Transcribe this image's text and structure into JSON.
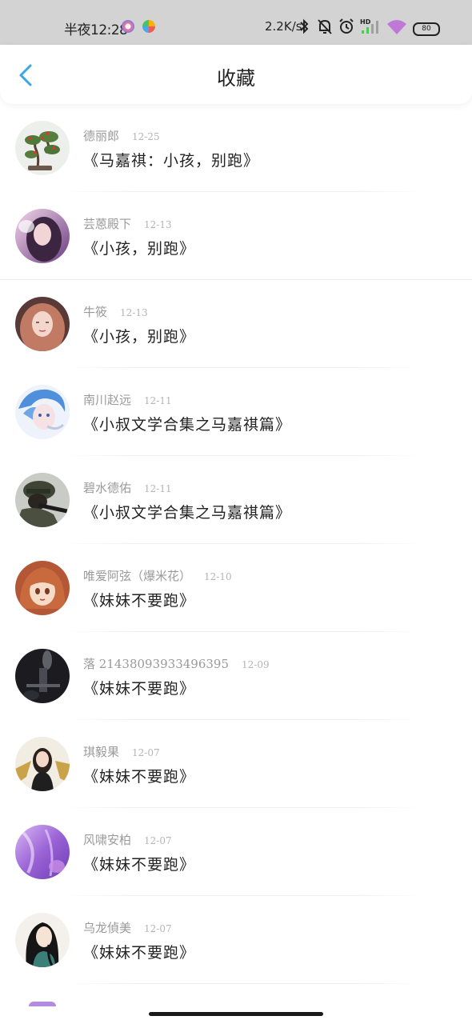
{
  "status_bar": {
    "time": "半夜12:28",
    "net_speed": "2.2K/s",
    "battery": "80",
    "icons": [
      "app-icon-1",
      "app-icon-2",
      "bluetooth-icon",
      "mute-bell-icon",
      "alarm-icon",
      "signal-icon",
      "wifi-icon",
      "battery-icon"
    ]
  },
  "header": {
    "title": "收藏",
    "back_icon": "chevron-left-icon",
    "accent": "#3aa6e6"
  },
  "favorites": [
    {
      "user": "德丽郎",
      "date": "12-25",
      "title": "《马嘉祺：小孩，别跑》",
      "avatar": "avatar-bonsai"
    },
    {
      "user": "芸蒽殿下",
      "date": "12-13",
      "title": "《小孩，别跑》",
      "avatar": "avatar-girl-purple"
    },
    {
      "user": "牛筱",
      "date": "12-13",
      "title": "《小孩，别跑》",
      "avatar": "avatar-girl-pink-hair"
    },
    {
      "user": "南川赵远",
      "date": "12-11",
      "title": "《小叔文学合集之马嘉祺篇》",
      "avatar": "avatar-anime-blue-hair"
    },
    {
      "user": "碧水德佑",
      "date": "12-11",
      "title": "《小叔文学合集之马嘉祺篇》",
      "avatar": "avatar-soldier"
    },
    {
      "user": "唯爱阿弦（爆米花）",
      "date": "12-10",
      "title": "《妹妹不要跑》",
      "avatar": "avatar-anime-orange-hair"
    },
    {
      "user": "落 21438093933496395",
      "date": "12-09",
      "title": "《妹妹不要跑》",
      "avatar": "avatar-dark-stage"
    },
    {
      "user": "琪毅果",
      "date": "12-07",
      "title": "《妹妹不要跑》",
      "avatar": "avatar-girl-gold"
    },
    {
      "user": "风啸安柏",
      "date": "12-07",
      "title": "《妹妹不要跑》",
      "avatar": "avatar-purple-abstract"
    },
    {
      "user": "乌龙偵美",
      "date": "12-07",
      "title": "《妹妹不要跑》",
      "avatar": "avatar-ink-girl"
    }
  ]
}
